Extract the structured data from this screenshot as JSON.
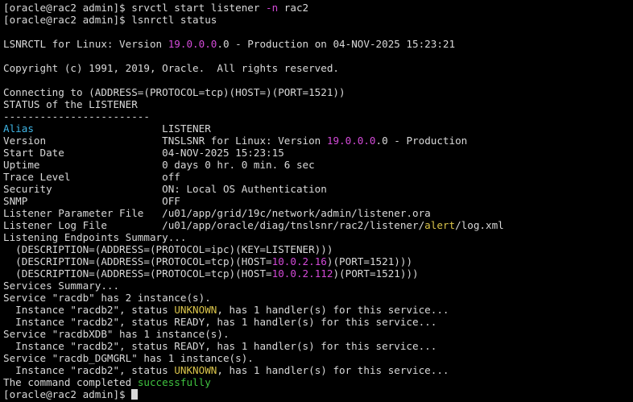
{
  "colors": {
    "background": "#000000",
    "text": "#d9d9d9",
    "magenta": "#d34ad8",
    "cyan": "#3fb6e6",
    "yellow": "#d9c34a",
    "green": "#3fc23f"
  },
  "terminal": {
    "lines": [
      {
        "segs": [
          {
            "t": "[oracle@rac2 admin]$ srvctl start listener "
          },
          {
            "t": "-n",
            "c": "magenta"
          },
          {
            "t": " rac2"
          }
        ]
      },
      {
        "segs": [
          {
            "t": "[oracle@rac2 admin]$ lsnrctl status"
          }
        ]
      },
      {
        "segs": []
      },
      {
        "segs": [
          {
            "t": "LSNRCTL for Linux: Version "
          },
          {
            "t": "19.0.0.0",
            "c": "magenta"
          },
          {
            "t": ".0 - Production on 04-NOV-2025 15:23:21"
          }
        ]
      },
      {
        "segs": []
      },
      {
        "segs": [
          {
            "t": "Copyright (c) 1991, 2019, Oracle.  All rights reserved."
          }
        ]
      },
      {
        "segs": []
      },
      {
        "segs": [
          {
            "t": "Connecting to (ADDRESS=(PROTOCOL=tcp)(HOST=)(PORT=1521))"
          }
        ]
      },
      {
        "segs": [
          {
            "t": "STATUS of the LISTENER"
          }
        ]
      },
      {
        "segs": [
          {
            "t": "------------------------"
          }
        ]
      },
      {
        "segs": [
          {
            "t": "Alias",
            "c": "cyan"
          },
          {
            "t": "                     LISTENER"
          }
        ]
      },
      {
        "segs": [
          {
            "t": "Version                   TNSLSNR for Linux: Version "
          },
          {
            "t": "19.0.0.0",
            "c": "magenta"
          },
          {
            "t": ".0 - Production"
          }
        ]
      },
      {
        "segs": [
          {
            "t": "Start Date                04-NOV-2025 15:23:15"
          }
        ]
      },
      {
        "segs": [
          {
            "t": "Uptime                    0 days 0 hr. 0 min. 6 sec"
          }
        ]
      },
      {
        "segs": [
          {
            "t": "Trace Level               off"
          }
        ]
      },
      {
        "segs": [
          {
            "t": "Security                  ON: Local OS Authentication"
          }
        ]
      },
      {
        "segs": [
          {
            "t": "SNMP                      OFF"
          }
        ]
      },
      {
        "segs": [
          {
            "t": "Listener Parameter File   /u01/app/grid/19c/network/admin/listener.ora"
          }
        ]
      },
      {
        "segs": [
          {
            "t": "Listener Log File         /u01/app/oracle/diag/tnslsnr/rac2/listener/"
          },
          {
            "t": "alert",
            "c": "yellow"
          },
          {
            "t": "/log.xml"
          }
        ]
      },
      {
        "segs": [
          {
            "t": "Listening Endpoints Summary..."
          }
        ]
      },
      {
        "segs": [
          {
            "t": "  (DESCRIPTION=(ADDRESS=(PROTOCOL=ipc)(KEY=LISTENER)))"
          }
        ]
      },
      {
        "segs": [
          {
            "t": "  (DESCRIPTION=(ADDRESS=(PROTOCOL=tcp)(HOST="
          },
          {
            "t": "10.0.2.16",
            "c": "magenta"
          },
          {
            "t": ")(PORT=1521)))"
          }
        ]
      },
      {
        "segs": [
          {
            "t": "  (DESCRIPTION=(ADDRESS=(PROTOCOL=tcp)(HOST="
          },
          {
            "t": "10.0.2.112",
            "c": "magenta"
          },
          {
            "t": ")(PORT=1521)))"
          }
        ]
      },
      {
        "segs": [
          {
            "t": "Services Summary..."
          }
        ]
      },
      {
        "segs": [
          {
            "t": "Service \"racdb\" has 2 instance(s)."
          }
        ]
      },
      {
        "segs": [
          {
            "t": "  Instance \"racdb2\", status "
          },
          {
            "t": "UNKNOWN",
            "c": "yellow"
          },
          {
            "t": ", has 1 handler(s) for this service..."
          }
        ]
      },
      {
        "segs": [
          {
            "t": "  Instance \"racdb2\", status READY, has 1 handler(s) for this service..."
          }
        ]
      },
      {
        "segs": [
          {
            "t": "Service \"racdbXDB\" has 1 instance(s)."
          }
        ]
      },
      {
        "segs": [
          {
            "t": "  Instance \"racdb2\", status READY, has 1 handler(s) for this service..."
          }
        ]
      },
      {
        "segs": [
          {
            "t": "Service \"racdb_DGMGRL\" has 1 instance(s)."
          }
        ]
      },
      {
        "segs": [
          {
            "t": "  Instance \"racdb2\", status "
          },
          {
            "t": "UNKNOWN",
            "c": "yellow"
          },
          {
            "t": ", has 1 handler(s) for this service..."
          }
        ]
      },
      {
        "segs": [
          {
            "t": "The command completed "
          },
          {
            "t": "successfully",
            "c": "green"
          }
        ]
      }
    ],
    "prompt": "[oracle@rac2 admin]$ "
  }
}
